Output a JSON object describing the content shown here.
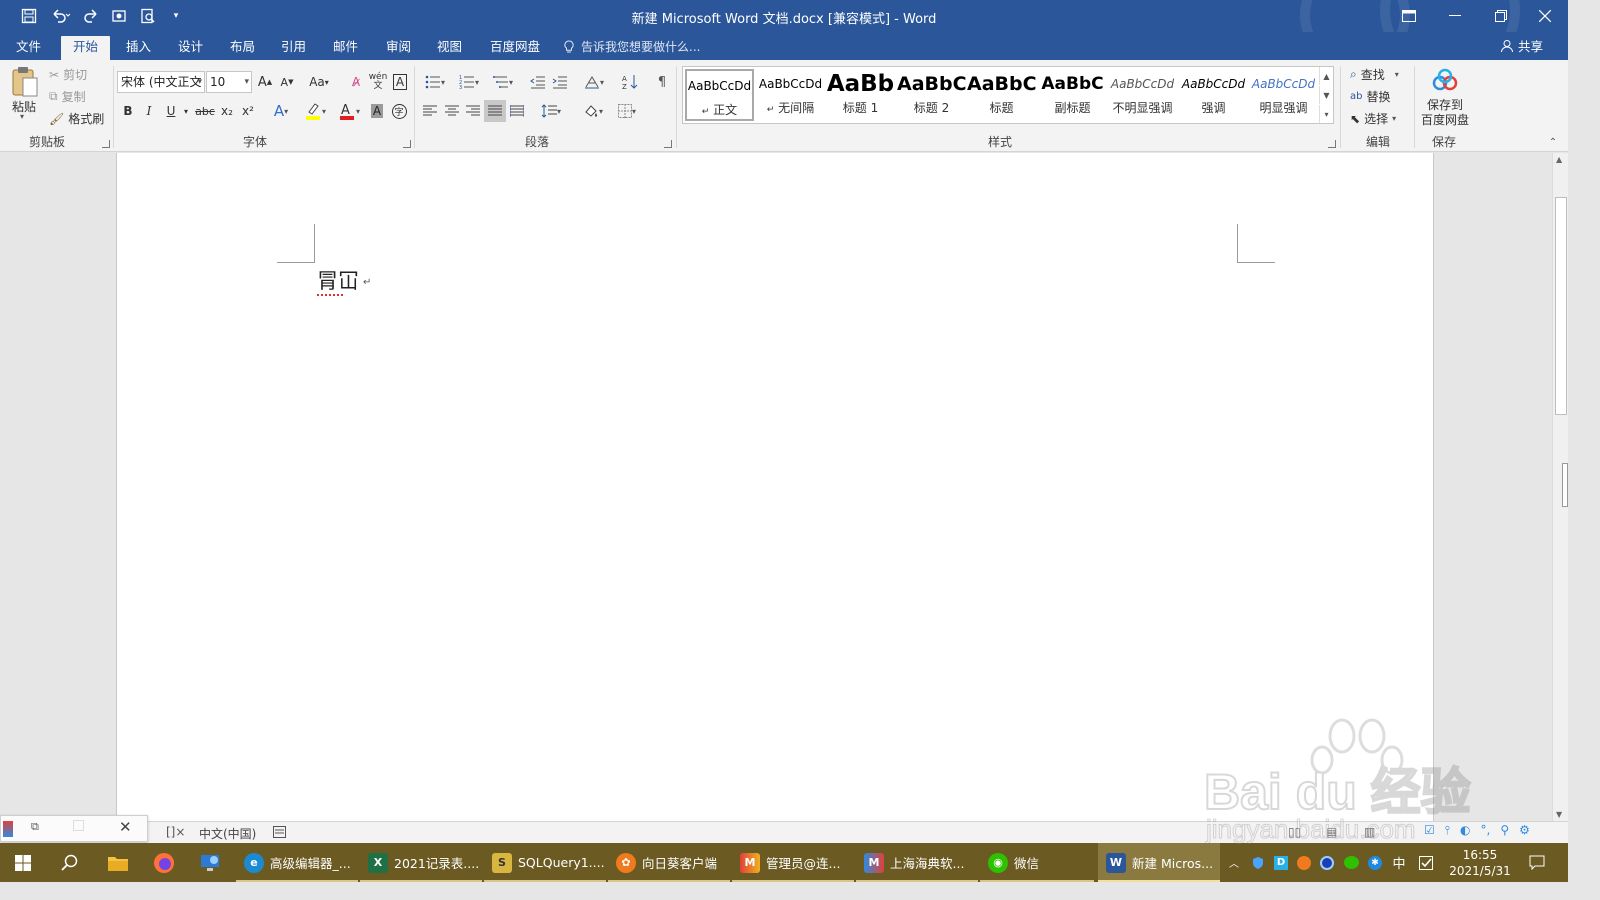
{
  "window": {
    "title": "新建 Microsoft Word 文档.docx [兼容模式] - Word"
  },
  "tabs": [
    "文件",
    "开始",
    "插入",
    "设计",
    "布局",
    "引用",
    "邮件",
    "审阅",
    "视图",
    "百度网盘"
  ],
  "tell_me": "告诉我您想要做什么...",
  "share_label": "共享",
  "clipboard": {
    "paste": "粘贴",
    "cut": "剪切",
    "copy": "复制",
    "format_painter": "格式刷",
    "label": "剪贴板"
  },
  "font": {
    "name": "宋体 (中文正文",
    "size": "10",
    "change_case": "Aa",
    "phonetic": "wén",
    "bold": "B",
    "italic": "I",
    "underline": "U",
    "strike": "abc",
    "subscript": "x₂",
    "superscript": "x²",
    "label": "字体"
  },
  "paragraph": {
    "label": "段落"
  },
  "styles": {
    "label": "样式",
    "items": [
      {
        "sample": "AaBbCcDd",
        "name": "正文",
        "mark": "↵"
      },
      {
        "sample": "AaBbCcDd",
        "name": "无间隔",
        "mark": "↵"
      },
      {
        "sample": "AaBb",
        "name": "标题 1"
      },
      {
        "sample": "AaBbC",
        "name": "标题 2"
      },
      {
        "sample": "AaBbC",
        "name": "标题"
      },
      {
        "sample": "AaBbC",
        "name": "副标题"
      },
      {
        "sample": "AaBbCcDd",
        "name": "不明显强调"
      },
      {
        "sample": "AaBbCcDd",
        "name": "强调"
      },
      {
        "sample": "AaBbCcDd",
        "name": "明显强调"
      }
    ]
  },
  "editing": {
    "find": "查找",
    "replace": "替换",
    "select": "选择",
    "label": "编辑"
  },
  "save_group": {
    "button_line1": "保存到",
    "button_line2": "百度网盘",
    "label": "保存"
  },
  "document": {
    "text": "冐冚",
    "para_mark": "↵"
  },
  "status": {
    "language": "中文(中国)"
  },
  "taskbar": {
    "apps": [
      {
        "label": "高级编辑器_..."
      },
      {
        "label": "2021记录表...."
      },
      {
        "label": "SQLQuery1...."
      },
      {
        "label": "向日葵客户端"
      },
      {
        "label": "管理员@连..."
      },
      {
        "label": "上海海典软..."
      },
      {
        "label": "微信"
      },
      {
        "label": "新建 Micros..."
      }
    ],
    "ime": "中",
    "time": "16:55",
    "date": "2021/5/31"
  },
  "watermark": {
    "brand": "Bai du 经验",
    "url": "jingyan.baidu.com"
  },
  "colors": {
    "word_blue": "#2b579a",
    "taskbar": "#6b5a22"
  }
}
